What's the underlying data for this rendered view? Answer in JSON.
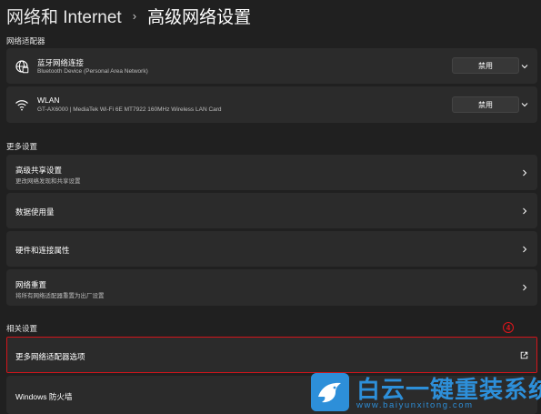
{
  "breadcrumb": {
    "parent": "网络和 Internet",
    "separator": "›",
    "current": "高级网络设置"
  },
  "sections": {
    "adapters": "网络适配器",
    "more_settings": "更多设置",
    "related": "相关设置"
  },
  "adapters": [
    {
      "name": "蓝牙网络连接",
      "description": "Bluetooth Device (Personal Area Network)",
      "button": "禁用",
      "icon": "globe-icon"
    },
    {
      "name": "WLAN",
      "description": "GT-AX6000 | MediaTek Wi-Fi 6E MT7922 160MHz Wireless LAN Card",
      "button": "禁用",
      "icon": "wifi-icon"
    }
  ],
  "more_settings": [
    {
      "title": "高级共享设置",
      "subtitle": "更改网络发现和共享设置"
    },
    {
      "title": "数据使用量",
      "subtitle": ""
    },
    {
      "title": "硬件和连接属性",
      "subtitle": ""
    },
    {
      "title": "网络重置",
      "subtitle": "将所有网络适配器重置为出厂设置"
    }
  ],
  "related": [
    {
      "title": "更多网络适配器选项",
      "icon": "external-link-icon"
    },
    {
      "title": "Windows 防火墙"
    }
  ],
  "annotation": {
    "step_badge": "4",
    "highlight_color": "#d4151b"
  },
  "watermark": {
    "brand": "白云一键重装系统",
    "url": "www.baiyunxitong.com",
    "color": "#2d8fd9"
  }
}
